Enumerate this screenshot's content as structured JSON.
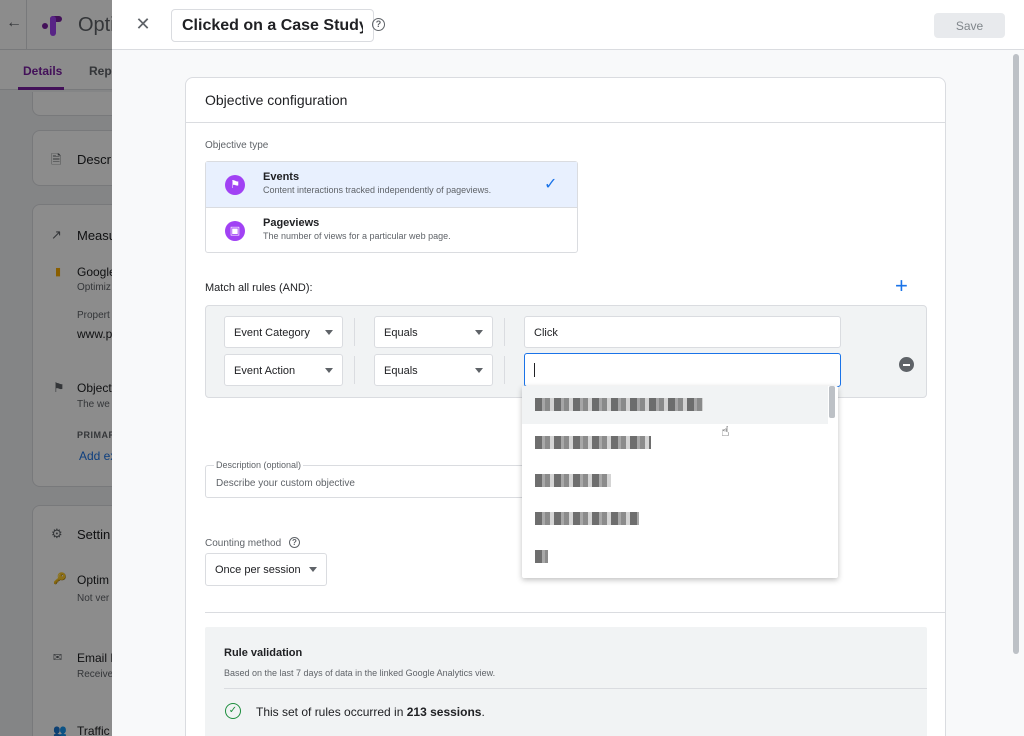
{
  "background": {
    "app_name": "Opti",
    "tabs": [
      "Details",
      "Repo"
    ],
    "sections": {
      "description": "Descr",
      "measurement": "Measu",
      "google_item": "Google",
      "google_sub": "Optimiz",
      "property_lbl": "Propert",
      "property_val": "www.pc",
      "objective": "Object",
      "objective_sub": "The we",
      "primary": "PRIMAR",
      "add_link": "Add ex",
      "settings": "Settin",
      "optim": "Optim",
      "optim_sub": "Not ver",
      "email": "Email N",
      "email_sub": "Receive",
      "traffic": "Traffic"
    }
  },
  "header": {
    "title_value": "Clicked on a Case Study",
    "save_label": "Save"
  },
  "config": {
    "card_title": "Objective configuration",
    "objective_type_label": "Objective type",
    "objective_types": [
      {
        "name": "Events",
        "description": "Content interactions tracked independently of pageviews.",
        "selected": true
      },
      {
        "name": "Pageviews",
        "description": "The number of views for a particular web page.",
        "selected": false
      }
    ],
    "match_label": "Match all rules (AND):",
    "rules": [
      {
        "field": "Event Category",
        "operator": "Equals",
        "value": "Click"
      },
      {
        "field": "Event Action",
        "operator": "Equals",
        "value": ""
      }
    ],
    "description_label": "Description (optional)",
    "description_placeholder": "Describe your custom objective",
    "counting_label": "Counting method",
    "counting_value": "Once per session"
  },
  "validation": {
    "title": "Rule validation",
    "description": "Based on the last 7 days of data in the linked Google Analytics view.",
    "result_prefix": "This set of rules occurred in ",
    "result_count": "213 sessions",
    "result_suffix": "."
  },
  "dropdown": {
    "item_count": 5
  },
  "colors": {
    "accent": "#1a73e8",
    "brand": "#7b1fa2",
    "objective_icon": "#a142f4",
    "success": "#1e8e3e"
  }
}
